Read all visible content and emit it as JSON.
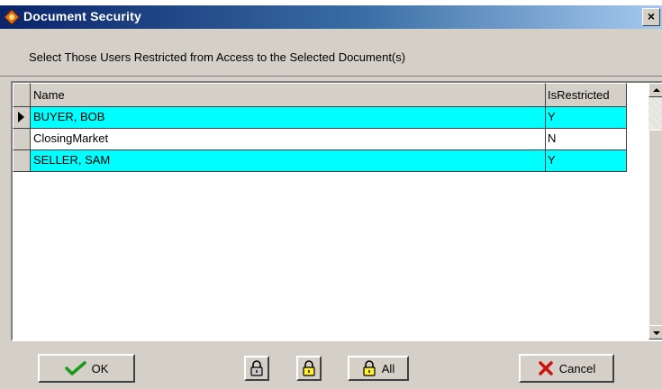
{
  "window": {
    "title": "Document Security",
    "close_glyph": "×",
    "icon": "app-icon"
  },
  "subtitle": "Select Those Users Restricted from Access to the Selected Document(s)",
  "grid": {
    "columns": [
      "Name",
      "IsRestricted"
    ],
    "rows": [
      {
        "name": "BUYER, BOB",
        "is_restricted": "Y",
        "highlighted": true,
        "current": true
      },
      {
        "name": "ClosingMarket",
        "is_restricted": "N",
        "highlighted": false,
        "current": false
      },
      {
        "name": "SELLER, SAM",
        "is_restricted": "Y",
        "highlighted": true,
        "current": false
      }
    ],
    "highlight_color": "#00ffff"
  },
  "buttons": {
    "ok": {
      "label": "OK",
      "icon": "checkmark-icon"
    },
    "lock": {
      "label": "",
      "icon": "lock-icon"
    },
    "lock_selected": {
      "label": "",
      "icon": "lock-highlight-icon"
    },
    "lock_all": {
      "label": "All",
      "icon": "lock-icon"
    },
    "cancel": {
      "label": "Cancel",
      "icon": "x-icon"
    }
  }
}
